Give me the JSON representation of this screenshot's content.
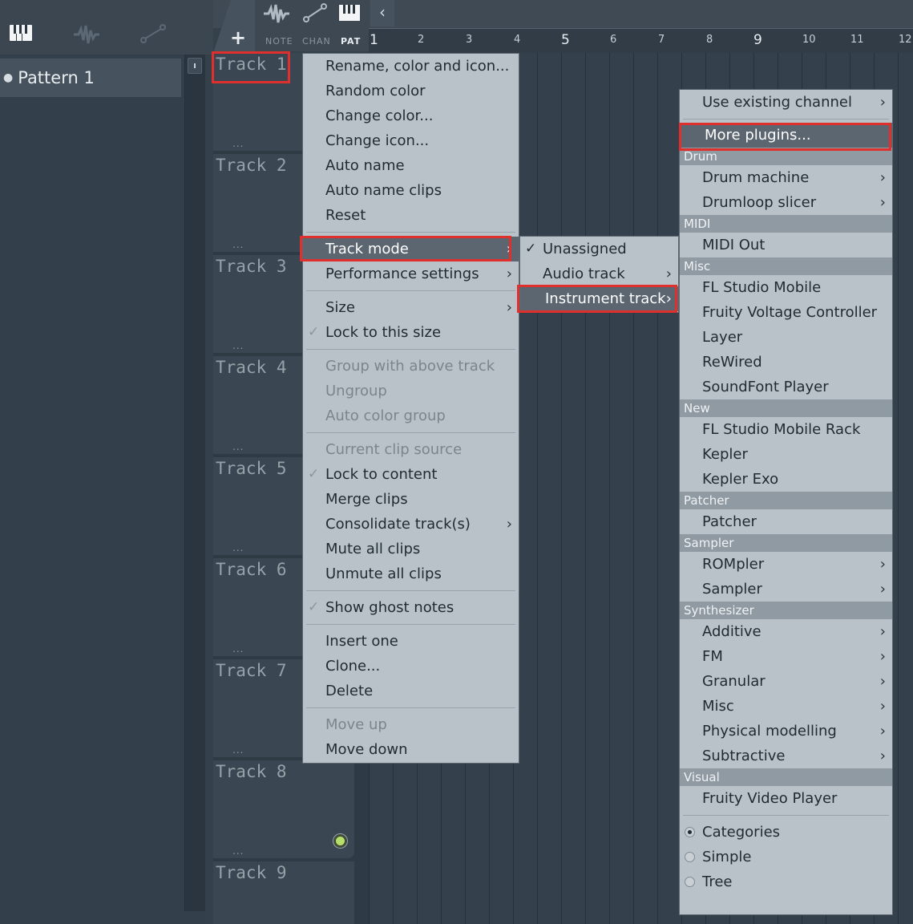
{
  "toolbar": {
    "top_tabs": [
      "NOTE",
      "CHAN",
      "PAT"
    ],
    "add_label": "+",
    "back_arrow": "‹"
  },
  "browser": {
    "pattern_label": "Pattern 1"
  },
  "ruler": {
    "ticks": [
      "1",
      "2",
      "3",
      "4",
      "5",
      "6",
      "7",
      "8",
      "9",
      "10",
      "11",
      "12"
    ]
  },
  "tracks": [
    "Track 1",
    "Track 2",
    "Track 3",
    "Track 4",
    "Track 5",
    "Track 6",
    "Track 7",
    "Track 8",
    "Track 9"
  ],
  "track_dots": "...",
  "context_menu": {
    "items": {
      "rename": "Rename, color and icon...",
      "random_color": "Random color",
      "change_color": "Change color...",
      "change_icon": "Change icon...",
      "auto_name": "Auto name",
      "auto_name_clips": "Auto name clips",
      "reset": "Reset",
      "track_mode": "Track mode",
      "performance_settings": "Performance settings",
      "size": "Size",
      "lock_to_size": "Lock to this size",
      "group_with_above": "Group with above track",
      "ungroup": "Ungroup",
      "auto_color_group": "Auto color group",
      "current_clip_source": "Current clip source",
      "lock_to_content": "Lock to content",
      "merge_clips": "Merge clips",
      "consolidate": "Consolidate track(s)",
      "mute_all": "Mute all clips",
      "unmute_all": "Unmute all clips",
      "show_ghost_notes": "Show ghost notes",
      "insert_one": "Insert one",
      "clone": "Clone...",
      "delete": "Delete",
      "move_up": "Move up",
      "move_down": "Move down"
    }
  },
  "track_mode_menu": {
    "unassigned": "Unassigned",
    "audio_track": "Audio track",
    "instrument_track": "Instrument track"
  },
  "plugin_menu": {
    "use_existing": "Use existing channel",
    "more_plugins": "More plugins...",
    "sections": {
      "drum": "Drum",
      "midi": "MIDI",
      "misc": "Misc",
      "new": "New",
      "patcher": "Patcher",
      "sampler": "Sampler",
      "synthesizer": "Synthesizer",
      "visual": "Visual"
    },
    "items": {
      "drum_machine": "Drum machine",
      "drumloop_slicer": "Drumloop slicer",
      "midi_out": "MIDI Out",
      "fl_studio_mobile": "FL Studio Mobile",
      "fruity_voltage": "Fruity Voltage Controller",
      "layer": "Layer",
      "rewired": "ReWired",
      "soundfont": "SoundFont Player",
      "fl_mobile_rack": "FL Studio Mobile Rack",
      "kepler": "Kepler",
      "kepler_exo": "Kepler Exo",
      "patcher": "Patcher",
      "rompler": "ROMpler",
      "sampler": "Sampler",
      "additive": "Additive",
      "fm": "FM",
      "granular": "Granular",
      "misc": "Misc",
      "physical": "Physical modelling",
      "subtractive": "Subtractive",
      "fruity_video": "Fruity Video Player"
    },
    "view_modes": {
      "categories": "Categories",
      "simple": "Simple",
      "tree": "Tree"
    }
  },
  "glyphs": {
    "arrow": "›",
    "check": "✓"
  },
  "colors": {
    "highlight_box": "#e0302e",
    "menu_bg": "#b9c2c9",
    "selected_bg": "#5b6671",
    "led_green": "#b6e06a"
  }
}
